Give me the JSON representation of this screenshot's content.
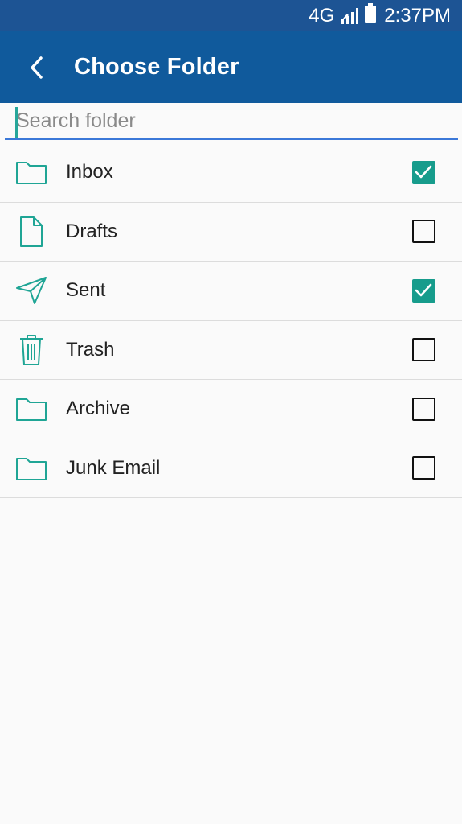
{
  "status": {
    "network": "4G",
    "time": "2:37PM"
  },
  "header": {
    "title": "Choose Folder"
  },
  "search": {
    "placeholder": "Search folder",
    "value": ""
  },
  "accent": "#179c8c",
  "folders": [
    {
      "label": "Inbox",
      "icon": "folder-icon",
      "checked": true
    },
    {
      "label": "Drafts",
      "icon": "document-icon",
      "checked": false
    },
    {
      "label": "Sent",
      "icon": "send-icon",
      "checked": true
    },
    {
      "label": "Trash",
      "icon": "trash-icon",
      "checked": false
    },
    {
      "label": "Archive",
      "icon": "folder-icon",
      "checked": false
    },
    {
      "label": "Junk Email",
      "icon": "folder-icon",
      "checked": false
    }
  ]
}
